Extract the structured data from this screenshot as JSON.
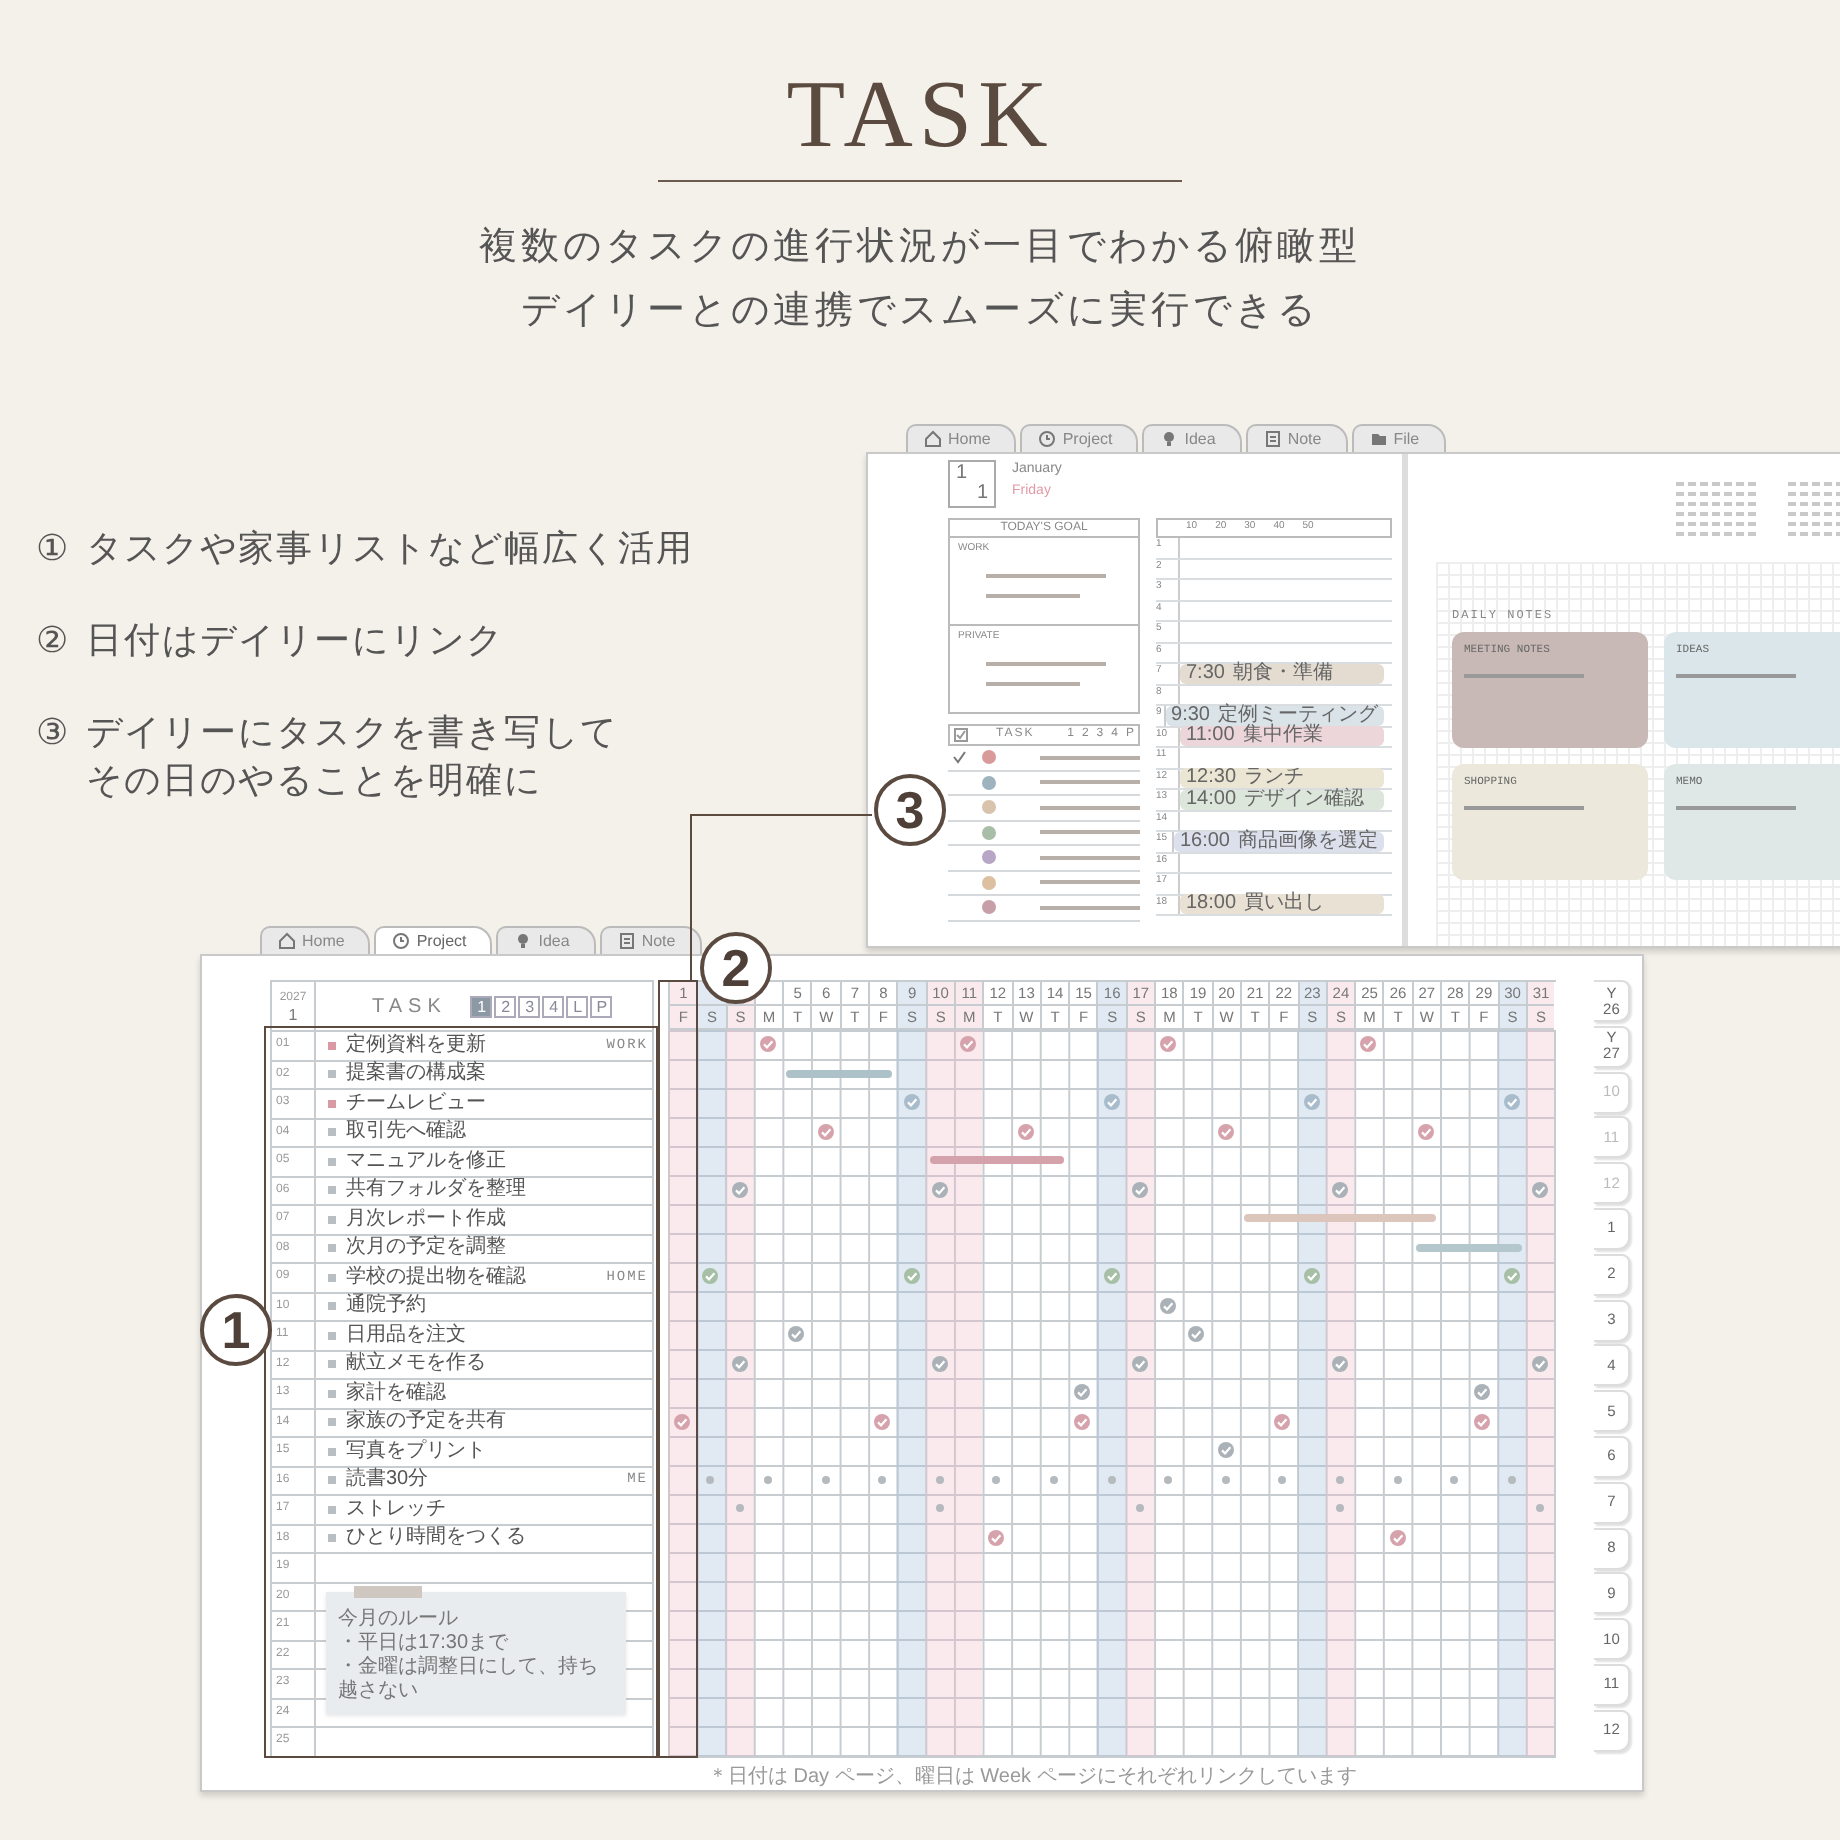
{
  "header": {
    "title": "TASK",
    "subtitle_lines": [
      "複数のタスクの進行状況が一目でわかる俯瞰型",
      "デイリーとの連携でスムーズに実行できる"
    ]
  },
  "features": [
    {
      "number": "①",
      "lines": [
        "タスクや家事リストなど幅広く活用"
      ]
    },
    {
      "number": "②",
      "lines": [
        "日付はデイリーにリンク"
      ]
    },
    {
      "number": "③",
      "lines": [
        "デイリーにタスクを書き写して",
        "その日のやることを明確に"
      ]
    }
  ],
  "daily_page": {
    "tabs": [
      {
        "label": "Home",
        "selected": false
      },
      {
        "label": "Project",
        "selected": false
      },
      {
        "label": "Idea",
        "selected": false
      },
      {
        "label": "Note",
        "selected": false
      },
      {
        "label": "File",
        "selected": false
      }
    ],
    "date": {
      "month": "1",
      "day": "1",
      "month_name": "January",
      "weekday": "Friday"
    },
    "goal_header": "TODAY'S GOAL",
    "goal_sections": [
      "WORK",
      "PRIVATE"
    ],
    "task_header": "TASK",
    "task_columns": [
      "1",
      "2",
      "3",
      "4",
      "P"
    ],
    "day_tasks": [
      {
        "done": true,
        "color": "#d99a9a"
      },
      {
        "done": false,
        "color": "#9fb3bf"
      },
      {
        "done": false,
        "color": "#d8c3ad"
      },
      {
        "done": false,
        "color": "#a9bea6"
      },
      {
        "done": false,
        "color": "#b7a6c6"
      },
      {
        "done": false,
        "color": "#dcc0a0"
      },
      {
        "done": false,
        "color": "#c79fa8"
      }
    ],
    "minutes": [
      "10",
      "20",
      "30",
      "40",
      "50"
    ],
    "hours": [
      {
        "label": "1"
      },
      {
        "label": "2"
      },
      {
        "label": "3"
      },
      {
        "label": "4"
      },
      {
        "label": "5"
      },
      {
        "label": "6"
      },
      {
        "label": "7",
        "event": {
          "time": "7:30",
          "text": "朝食・準備",
          "color": "#e4dcd0"
        }
      },
      {
        "label": "8"
      },
      {
        "label": "9",
        "event": {
          "time": "9:30",
          "text": "定例ミーティング",
          "color": "#d9e3e8"
        }
      },
      {
        "label": "10",
        "event": {
          "time": "11:00",
          "text": "集中作業",
          "color": "#ecd6da"
        }
      },
      {
        "label": "11"
      },
      {
        "label": "12",
        "event": {
          "time": "12:30",
          "text": "ランチ",
          "color": "#ebe5d3"
        }
      },
      {
        "label": "13",
        "event": {
          "time": "14:00",
          "text": "デザイン確認",
          "color": "#dde6da"
        }
      },
      {
        "label": "14"
      },
      {
        "label": "15",
        "event": {
          "time": "16:00",
          "text": "商品画像を選定",
          "color": "#dcdfec"
        }
      },
      {
        "label": "16"
      },
      {
        "label": "17"
      },
      {
        "label": "18",
        "event": {
          "time": "18:00",
          "text": "買い出し",
          "color": "#e9e1d3"
        }
      }
    ],
    "notes_title": "DAILY NOTES",
    "notes": [
      {
        "title": "MEETING NOTES",
        "color": "#c9b9b6"
      },
      {
        "title": "IDEAS",
        "color": "#dbe6ea"
      },
      {
        "title": "SHOPPING",
        "color": "#ece8dc"
      },
      {
        "title": "MEMO",
        "color": "#dfe8e7"
      }
    ]
  },
  "planner": {
    "tabs": [
      {
        "label": "Home",
        "selected": false
      },
      {
        "label": "Project",
        "selected": true
      },
      {
        "label": "Idea",
        "selected": false
      },
      {
        "label": "Note",
        "selected": false
      }
    ],
    "year": "2027",
    "month": "1",
    "title": "TASK",
    "page_tabs": [
      {
        "label": "1",
        "selected": true
      },
      {
        "label": "2",
        "selected": false
      },
      {
        "label": "3",
        "selected": false
      },
      {
        "label": "4",
        "selected": false
      },
      {
        "label": "L",
        "selected": false
      },
      {
        "label": "P",
        "selected": false
      }
    ],
    "days": [
      {
        "date": "1",
        "weekday": "F",
        "kind": "holiday"
      },
      {
        "weekday": "S",
        "kind": "saturday"
      },
      {
        "weekday": "S",
        "kind": "holiday"
      },
      {
        "weekday": "M",
        "kind": "weekday"
      },
      {
        "date": "5",
        "weekday": "T",
        "kind": "weekday"
      },
      {
        "date": "6",
        "weekday": "W",
        "kind": "weekday"
      },
      {
        "date": "7",
        "weekday": "T",
        "kind": "weekday"
      },
      {
        "date": "8",
        "weekday": "F",
        "kind": "weekday"
      },
      {
        "date": "9",
        "weekday": "S",
        "kind": "saturday"
      },
      {
        "date": "10",
        "weekday": "S",
        "kind": "holiday"
      },
      {
        "date": "11",
        "weekday": "M",
        "kind": "holiday"
      },
      {
        "date": "12",
        "weekday": "T",
        "kind": "weekday"
      },
      {
        "date": "13",
        "weekday": "W",
        "kind": "weekday"
      },
      {
        "date": "14",
        "weekday": "T",
        "kind": "weekday"
      },
      {
        "date": "15",
        "weekday": "F",
        "kind": "weekday"
      },
      {
        "date": "16",
        "weekday": "S",
        "kind": "saturday"
      },
      {
        "date": "17",
        "weekday": "S",
        "kind": "holiday"
      },
      {
        "date": "18",
        "weekday": "M",
        "kind": "weekday"
      },
      {
        "date": "19",
        "weekday": "T",
        "kind": "weekday"
      },
      {
        "date": "20",
        "weekday": "W",
        "kind": "weekday"
      },
      {
        "date": "21",
        "weekday": "T",
        "kind": "weekday"
      },
      {
        "date": "22",
        "weekday": "F",
        "kind": "weekday"
      },
      {
        "date": "23",
        "weekday": "S",
        "kind": "saturday"
      },
      {
        "date": "24",
        "weekday": "S",
        "kind": "holiday"
      },
      {
        "date": "25",
        "weekday": "M",
        "kind": "weekday"
      },
      {
        "date": "26",
        "weekday": "T",
        "kind": "weekday"
      },
      {
        "date": "27",
        "weekday": "W",
        "kind": "weekday"
      },
      {
        "date": "28",
        "weekday": "T",
        "kind": "weekday"
      },
      {
        "date": "29",
        "weekday": "F",
        "kind": "weekday"
      },
      {
        "date": "30",
        "weekday": "S",
        "kind": "saturday"
      },
      {
        "date": "31",
        "weekday": "S",
        "kind": "holiday"
      }
    ],
    "tasks": [
      {
        "number": "01",
        "text": "定例資料を更新",
        "category": "WORK",
        "bullet": {
          "color": "#d99aa6"
        },
        "kind": "check",
        "color": "#d6a3ad",
        "marked": [
          false,
          false,
          false,
          true,
          false,
          false,
          false,
          false,
          false,
          false,
          true,
          false,
          false,
          false,
          false,
          false,
          false,
          true,
          false,
          false,
          false,
          false,
          false,
          false,
          true,
          false,
          false,
          false,
          false,
          false,
          false
        ]
      },
      {
        "number": "02",
        "text": "提案書の構成案",
        "bullet": {
          "color": "#b9bec3"
        },
        "kind": "bar",
        "color": "#adc1c9",
        "marked": [
          false,
          false,
          false,
          false,
          true,
          true,
          true,
          true,
          false,
          false,
          false,
          false,
          false,
          false,
          false,
          false,
          false,
          false,
          false,
          false,
          false,
          false,
          false,
          false,
          false,
          false,
          false,
          false,
          false,
          false,
          false
        ]
      },
      {
        "number": "03",
        "text": "チームレビュー",
        "bullet": {
          "color": "#d99aa6"
        },
        "kind": "check",
        "color": "#a9bccb",
        "marked": [
          false,
          false,
          false,
          false,
          false,
          false,
          false,
          false,
          true,
          false,
          false,
          false,
          false,
          false,
          false,
          true,
          false,
          false,
          false,
          false,
          false,
          false,
          true,
          false,
          false,
          false,
          false,
          false,
          false,
          true,
          false
        ]
      },
      {
        "number": "04",
        "text": "取引先へ確認",
        "bullet": {
          "color": "#b9bec3"
        },
        "kind": "check",
        "color": "#d6a3ad",
        "marked": [
          false,
          false,
          false,
          false,
          false,
          true,
          false,
          false,
          false,
          false,
          false,
          false,
          true,
          false,
          false,
          false,
          false,
          false,
          false,
          true,
          false,
          false,
          false,
          false,
          false,
          false,
          true,
          false,
          false,
          false,
          false
        ]
      },
      {
        "number": "05",
        "text": "マニュアルを修正",
        "bullet": {
          "color": "#b9bec3"
        },
        "kind": "bar",
        "color": "#d4a2ab",
        "marked": [
          false,
          false,
          false,
          false,
          false,
          false,
          false,
          false,
          false,
          true,
          true,
          true,
          true,
          true,
          false,
          false,
          false,
          false,
          false,
          false,
          false,
          false,
          false,
          false,
          false,
          false,
          false,
          false,
          false,
          false,
          false
        ]
      },
      {
        "number": "06",
        "text": "共有フォルダを整理",
        "bullet": {
          "color": "#b9bec3"
        },
        "kind": "check",
        "color": "#aab2b8",
        "marked": [
          false,
          false,
          true,
          false,
          false,
          false,
          false,
          false,
          false,
          true,
          false,
          false,
          false,
          false,
          false,
          false,
          true,
          false,
          false,
          false,
          false,
          false,
          false,
          true,
          false,
          false,
          false,
          false,
          false,
          false,
          true
        ]
      },
      {
        "number": "07",
        "text": "月次レポート作成",
        "bullet": {
          "color": "#b9bec3"
        },
        "kind": "bar",
        "color": "#dcc5bb",
        "marked": [
          false,
          false,
          false,
          false,
          false,
          false,
          false,
          false,
          false,
          false,
          false,
          false,
          false,
          false,
          false,
          false,
          false,
          false,
          false,
          false,
          true,
          true,
          true,
          true,
          true,
          true,
          true,
          false,
          false,
          false,
          false
        ]
      },
      {
        "number": "08",
        "text": "次月の予定を調整",
        "bullet": {
          "color": "#b9bec3"
        },
        "kind": "bar",
        "color": "#b3c7cd",
        "marked": [
          false,
          false,
          false,
          false,
          false,
          false,
          false,
          false,
          false,
          false,
          false,
          false,
          false,
          false,
          false,
          false,
          false,
          false,
          false,
          false,
          false,
          false,
          false,
          false,
          false,
          false,
          true,
          true,
          true,
          true,
          false
        ]
      },
      {
        "number": "09",
        "text": "学校の提出物を確認",
        "category": "HOME",
        "bullet": {
          "color": "#b9bec3"
        },
        "kind": "check",
        "color": "#a6bfa6",
        "marked": [
          false,
          true,
          false,
          false,
          false,
          false,
          false,
          false,
          true,
          false,
          false,
          false,
          false,
          false,
          false,
          true,
          false,
          false,
          false,
          false,
          false,
          false,
          true,
          false,
          false,
          false,
          false,
          false,
          false,
          true,
          false
        ]
      },
      {
        "number": "10",
        "text": "通院予約",
        "bullet": {
          "color": "#b9bec3"
        },
        "kind": "check",
        "color": "#aab2b8",
        "marked": [
          false,
          false,
          false,
          false,
          false,
          false,
          false,
          false,
          false,
          false,
          false,
          false,
          false,
          false,
          false,
          false,
          false,
          true,
          false,
          false,
          false,
          false,
          false,
          false,
          false,
          false,
          false,
          false,
          false,
          false,
          false
        ]
      },
      {
        "number": "11",
        "text": "日用品を注文",
        "bullet": {
          "color": "#b9bec3"
        },
        "kind": "check",
        "color": "#aab2b8",
        "marked": [
          false,
          false,
          false,
          false,
          true,
          false,
          false,
          false,
          false,
          false,
          false,
          false,
          false,
          false,
          false,
          false,
          false,
          false,
          true,
          false,
          false,
          false,
          false,
          false,
          false,
          false,
          false,
          false,
          false,
          false,
          false
        ]
      },
      {
        "number": "12",
        "text": "献立メモを作る",
        "bullet": {
          "color": "#b9bec3"
        },
        "kind": "check",
        "color": "#aab2b8",
        "marked": [
          false,
          false,
          true,
          false,
          false,
          false,
          false,
          false,
          false,
          true,
          false,
          false,
          false,
          false,
          false,
          false,
          true,
          false,
          false,
          false,
          false,
          false,
          false,
          true,
          false,
          false,
          false,
          false,
          false,
          false,
          true
        ]
      },
      {
        "number": "13",
        "text": "家計を確認",
        "bullet": {
          "color": "#b9bec3"
        },
        "kind": "check",
        "color": "#aab2b8",
        "marked": [
          false,
          false,
          false,
          false,
          false,
          false,
          false,
          false,
          false,
          false,
          false,
          false,
          false,
          false,
          true,
          false,
          false,
          false,
          false,
          false,
          false,
          false,
          false,
          false,
          false,
          false,
          false,
          false,
          true,
          false,
          false
        ]
      },
      {
        "number": "14",
        "text": "家族の予定を共有",
        "bullet": {
          "color": "#b9bec3"
        },
        "kind": "check",
        "color": "#d6a3ad",
        "marked": [
          true,
          false,
          false,
          false,
          false,
          false,
          false,
          true,
          false,
          false,
          false,
          false,
          false,
          false,
          true,
          false,
          false,
          false,
          false,
          false,
          false,
          true,
          false,
          false,
          false,
          false,
          false,
          false,
          true,
          false,
          false
        ]
      },
      {
        "number": "15",
        "text": "写真をプリント",
        "bullet": {
          "color": "#b9bec3"
        },
        "kind": "check",
        "color": "#aab2b8",
        "marked": [
          false,
          false,
          false,
          false,
          false,
          false,
          false,
          false,
          false,
          false,
          false,
          false,
          false,
          false,
          false,
          false,
          false,
          false,
          false,
          true,
          false,
          false,
          false,
          false,
          false,
          false,
          false,
          false,
          false,
          false,
          false
        ]
      },
      {
        "number": "16",
        "text": "読書30分",
        "category": "ME",
        "bullet": {
          "color": "#b9bec3"
        },
        "kind": "dot",
        "marked": [
          false,
          true,
          false,
          true,
          false,
          true,
          false,
          true,
          false,
          true,
          false,
          true,
          false,
          true,
          false,
          true,
          false,
          true,
          false,
          true,
          false,
          true,
          false,
          true,
          false,
          true,
          false,
          true,
          false,
          true,
          false
        ]
      },
      {
        "number": "17",
        "text": "ストレッチ",
        "bullet": {
          "color": "#b9bec3"
        },
        "kind": "dot",
        "marked": [
          false,
          false,
          true,
          false,
          false,
          false,
          false,
          false,
          false,
          true,
          false,
          false,
          false,
          false,
          false,
          false,
          true,
          false,
          false,
          false,
          false,
          false,
          false,
          true,
          false,
          false,
          false,
          false,
          false,
          false,
          true
        ]
      },
      {
        "number": "18",
        "text": "ひとり時間をつくる",
        "bullet": {
          "color": "#b9bec3"
        },
        "kind": "check",
        "color": "#d6a3ad",
        "marked": [
          false,
          false,
          false,
          false,
          false,
          false,
          false,
          false,
          false,
          false,
          false,
          true,
          false,
          false,
          false,
          false,
          false,
          false,
          false,
          false,
          false,
          false,
          false,
          false,
          false,
          true,
          false,
          false,
          false,
          false,
          false
        ]
      },
      {
        "number": "19"
      },
      {
        "number": "20"
      },
      {
        "number": "21"
      },
      {
        "number": "22"
      },
      {
        "number": "23"
      },
      {
        "number": "24"
      },
      {
        "number": "25"
      }
    ],
    "sticky_note": {
      "title": "今月のルール",
      "lines": [
        "・平日は17:30まで",
        "・金曜は調整日にして、持ち越さない"
      ]
    },
    "month_tabs": [
      {
        "kind": "year",
        "prefix": "Y",
        "label": "26",
        "muted": false
      },
      {
        "kind": "year",
        "prefix": "Y",
        "label": "27",
        "muted": false
      },
      {
        "kind": "month",
        "label": "10",
        "muted": true
      },
      {
        "kind": "month",
        "label": "11",
        "muted": true
      },
      {
        "kind": "month",
        "label": "12",
        "muted": true
      },
      {
        "kind": "month",
        "label": "1",
        "muted": false
      },
      {
        "kind": "month",
        "label": "2",
        "muted": false
      },
      {
        "kind": "month",
        "label": "3",
        "muted": false
      },
      {
        "kind": "month",
        "label": "4",
        "muted": false
      },
      {
        "kind": "month",
        "label": "5",
        "muted": false
      },
      {
        "kind": "month",
        "label": "6",
        "muted": false
      },
      {
        "kind": "month",
        "label": "7",
        "muted": false
      },
      {
        "kind": "month",
        "label": "8",
        "muted": false
      },
      {
        "kind": "month",
        "label": "9",
        "muted": false
      },
      {
        "kind": "month",
        "label": "10",
        "muted": false
      },
      {
        "kind": "month",
        "label": "11",
        "muted": false
      },
      {
        "kind": "month",
        "label": "12",
        "muted": false
      }
    ],
    "footer": "＊日付は Day ページ、曜日は Week ページにそれぞれリンクしています"
  },
  "callouts": [
    {
      "label": "1"
    },
    {
      "label": "2"
    },
    {
      "label": "3"
    }
  ]
}
